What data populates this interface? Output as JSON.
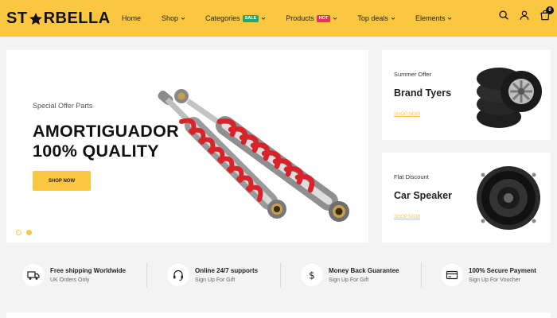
{
  "brand": {
    "name_left": "ST",
    "name_right": "RBELLA"
  },
  "nav": {
    "items": [
      {
        "label": "Home",
        "has_dropdown": false
      },
      {
        "label": "Shop",
        "has_dropdown": true
      },
      {
        "label": "Categories",
        "has_dropdown": true,
        "badge": "SALE",
        "badge_color": "#1fa67a"
      },
      {
        "label": "Products",
        "has_dropdown": true,
        "badge": "HOT",
        "badge_color": "#e8306b"
      },
      {
        "label": "Top deals",
        "has_dropdown": true
      },
      {
        "label": "Elements",
        "has_dropdown": true
      }
    ]
  },
  "header_icons": {
    "search": "search-icon",
    "account": "user-icon",
    "cart": "bag-icon",
    "cart_count": "0"
  },
  "hero": {
    "subtitle": "Special Offer Parts",
    "title_line1": "AMORTIGUADOR",
    "title_line2": "100% QUALITY",
    "button": "SHOP NOW",
    "slides": 2,
    "active_slide": 2
  },
  "banners": [
    {
      "subtitle": "Summer Offer",
      "title": "Brand Tyers",
      "link": "SHOP NOW"
    },
    {
      "subtitle": "Flat Discount",
      "title": "Car Speaker",
      "link": "SHOP NOW"
    }
  ],
  "features": [
    {
      "icon": "truck-icon",
      "title": "Free shipping Worldwide",
      "subtitle": "UK Orders Only"
    },
    {
      "icon": "headset-icon",
      "title": "Online 24/7 supports",
      "subtitle": "Sign Up For Gift"
    },
    {
      "icon": "dollar-icon",
      "title": "Money Back Guarantee",
      "subtitle": "Sign Up For Gift"
    },
    {
      "icon": "card-icon",
      "title": "100% Secure Payment",
      "subtitle": "Sign Up For Voucher"
    }
  ],
  "colors": {
    "accent": "#fcc740",
    "sale": "#1fa67a",
    "hot": "#e8306b",
    "spring_red": "#d8232a"
  }
}
